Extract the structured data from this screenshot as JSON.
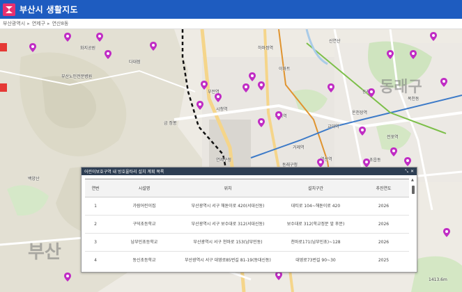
{
  "header": {
    "title": "부산시 생활지도",
    "brand_color": "#1e5cc0"
  },
  "breadcrumb": {
    "items": [
      "부산광역시",
      "연제구",
      "연산8동"
    ]
  },
  "map": {
    "district_labels": [
      "부산",
      "동래구"
    ],
    "places": [
      "화지공원",
      "하마정역",
      "부산진구청",
      "부전역",
      "동의대역",
      "다대점",
      "부산노인전문병원",
      "신연산",
      "이마트",
      "시청역",
      "연산역",
      "교대역",
      "거제역",
      "구서역",
      "연제구청",
      "동래역",
      "명륜역",
      "서면역",
      "온천장역",
      "학익",
      "동래구청",
      "사직역",
      "복천동",
      "한적장",
      "전포역",
      "초읍동",
      "시민공원",
      "온천장",
      "새마을",
      "금정봉",
      "백양산",
      "금 정봉",
      "수안역",
      "낙민역",
      "충렬사역",
      "안락동",
      "반송"
    ],
    "route_label": "1413.6m"
  },
  "panel": {
    "title": "어린이보호구역 내 방호울타리 설치 계획 목록",
    "controls": [
      "⤡",
      "✕"
    ],
    "columns": [
      "연번",
      "시설명",
      "위치",
      "설치구간",
      "추진연도"
    ],
    "rows": [
      {
        "no": "1",
        "name": "가람어린이집",
        "location": "부산광역시 서구 해돋이로 420(서대신동)",
        "section": "대티로 104~해돋이로 420",
        "year": "2026"
      },
      {
        "no": "2",
        "name": "구덕초등학교",
        "location": "부산광역시 서구 보수대로 312(서대신동)",
        "section": "보수대로 312(학교정문 앞 후문)",
        "year": "2026"
      },
      {
        "no": "3",
        "name": "남부민초등학교",
        "location": "부산광역시 서구 천마로 153(남부민동)",
        "section": "천마로171(남부민초)~128",
        "year": "2026"
      },
      {
        "no": "4",
        "name": "동신초등학교",
        "location": "부산광역시 서구 대영로85번길 81-19(동대신동)",
        "section": "대영로73번길 90~30",
        "year": "2025"
      }
    ]
  },
  "colors": {
    "pin": "#c02cc4",
    "panel_header": "#2d3e53",
    "map_bg": "#f2efe9"
  }
}
